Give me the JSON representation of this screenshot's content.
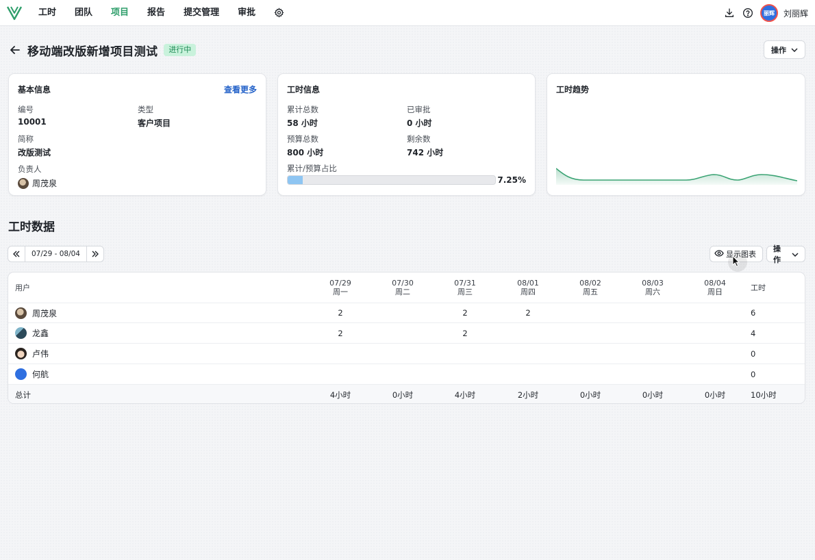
{
  "nav": {
    "items": [
      {
        "label": "工时",
        "active": false
      },
      {
        "label": "团队",
        "active": false
      },
      {
        "label": "项目",
        "active": true
      },
      {
        "label": "报告",
        "active": false
      },
      {
        "label": "提交管理",
        "active": false
      },
      {
        "label": "审批",
        "active": false
      }
    ],
    "icons": [
      "settings-gear-icon",
      "download-icon",
      "help-icon"
    ],
    "user": {
      "name": "刘丽辉",
      "avatar_text": "丽辉"
    }
  },
  "header": {
    "title": "移动端改版新增项目测试",
    "status": "进行中",
    "ops_label": "操作"
  },
  "basic_info": {
    "title": "基本信息",
    "more_link": "查看更多",
    "id_label": "编号",
    "id_value": "10001",
    "type_label": "类型",
    "type_value": "客户项目",
    "short_label": "简称",
    "short_value": "改版测试",
    "owner_label": "负责人",
    "owner_name": "周茂泉"
  },
  "hours_info": {
    "title": "工时信息",
    "total_label": "累计总数",
    "total_value": "58 小时",
    "approved_label": "已审批",
    "approved_value": "0 小时",
    "budget_label": "预算总数",
    "budget_value": "800 小时",
    "remaining_label": "剩余数",
    "remaining_value": "742 小时",
    "ratio_label": "累计/预算占比",
    "ratio_text": "7.25%",
    "ratio_fraction": 0.0725,
    "bar_color": "#8ec5f2"
  },
  "trend": {
    "title": "工时趋势",
    "line_color": "#3aa373"
  },
  "section": {
    "title": "工时数据",
    "date_range": "07/29 - 08/04",
    "show_chart_label": "显示图表",
    "ops_label": "操作"
  },
  "table": {
    "user_header": "用户",
    "total_header": "工时",
    "days": [
      {
        "date": "07/29",
        "weekday": "周一"
      },
      {
        "date": "07/30",
        "weekday": "周二"
      },
      {
        "date": "07/31",
        "weekday": "周三"
      },
      {
        "date": "08/01",
        "weekday": "周四"
      },
      {
        "date": "08/02",
        "weekday": "周五"
      },
      {
        "date": "08/03",
        "weekday": "周六"
      },
      {
        "date": "08/04",
        "weekday": "周日"
      }
    ],
    "rows": [
      {
        "name": "周茂泉",
        "cells": [
          "2",
          "",
          "2",
          "2",
          "",
          "",
          ""
        ],
        "total": "6"
      },
      {
        "name": "龙鑫",
        "cells": [
          "2",
          "",
          "2",
          "",
          "",
          "",
          ""
        ],
        "total": "4"
      },
      {
        "name": "卢伟",
        "cells": [
          "",
          "",
          "",
          "",
          "",
          "",
          ""
        ],
        "total": "0"
      },
      {
        "name": "何航",
        "cells": [
          "",
          "",
          "",
          "",
          "",
          "",
          ""
        ],
        "total": "0"
      }
    ],
    "footer": {
      "label": "总计",
      "cells": [
        "4小时",
        "0小时",
        "4小时",
        "2小时",
        "0小时",
        "0小时",
        "0小时"
      ],
      "total": "10小时"
    }
  },
  "colors": {
    "accent": "#2f9e6b",
    "link": "#2563c9",
    "status_bg": "#c9f2dc"
  }
}
